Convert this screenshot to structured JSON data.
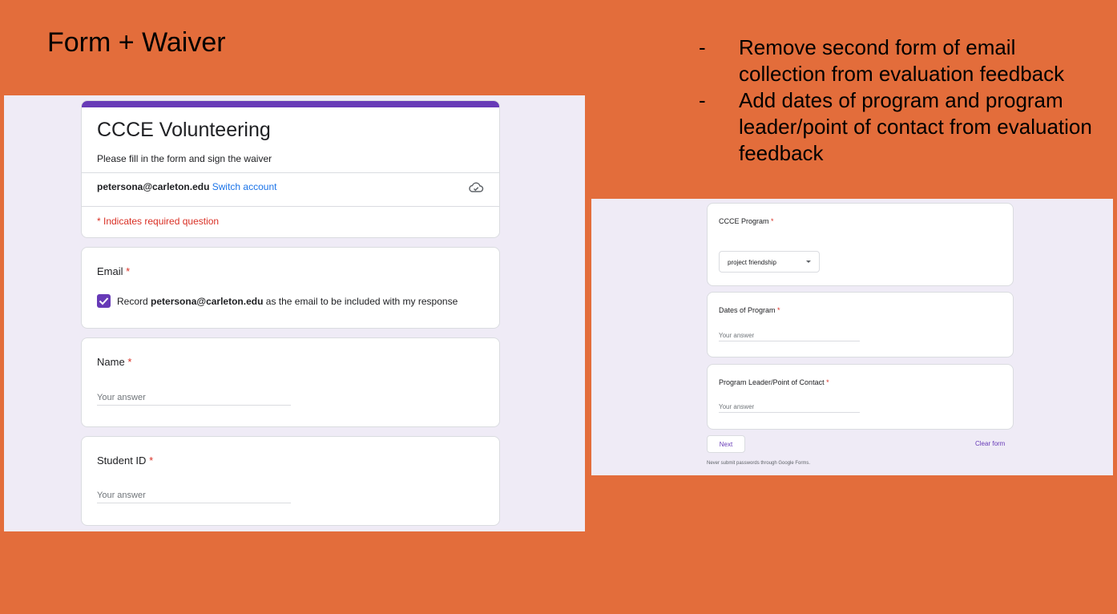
{
  "slide": {
    "title": "Form + Waiver",
    "bullets": [
      "Remove second form of email collection from evaluation feedback",
      "Add dates of program and program leader/point of contact from evaluation feedback"
    ]
  },
  "left_form": {
    "title": "CCCE Volunteering",
    "description": "Please fill in the form and sign the waiver",
    "account_email": "petersona@carleton.edu",
    "switch_account": "Switch account",
    "required_note": "* Indicates required question",
    "email_question": {
      "label": "Email",
      "star": "*",
      "record_prefix": "Record",
      "record_email": "petersona@carleton.edu",
      "record_suffix": "as the email to be included with my response"
    },
    "name_question": {
      "label": "Name",
      "star": "*",
      "placeholder": "Your answer"
    },
    "student_id_question": {
      "label": "Student ID",
      "star": "*",
      "placeholder": "Your answer"
    },
    "accent_color": "#673ab7"
  },
  "right_form": {
    "program_question": {
      "label": "CCCE Program",
      "star": "*",
      "selected": "project friendship"
    },
    "dates_question": {
      "label": "Dates of Program",
      "star": "*",
      "placeholder": "Your answer"
    },
    "leader_question": {
      "label": "Program Leader/Point of Contact",
      "star": "*",
      "placeholder": "Your answer"
    },
    "next_label": "Next",
    "clear_label": "Clear form",
    "footer_note": "Never submit passwords through Google Forms."
  }
}
